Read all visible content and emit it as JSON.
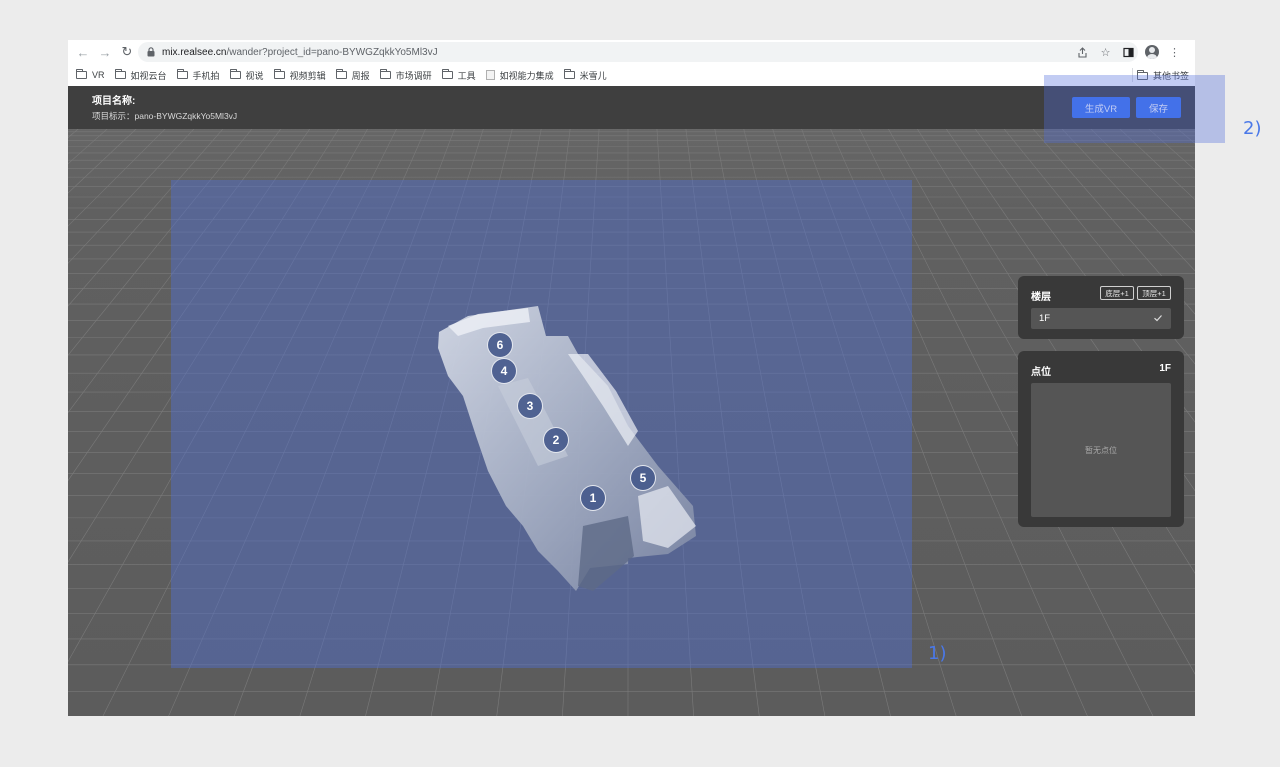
{
  "browser": {
    "url_host": "mix.realsee.cn",
    "url_path": "/wander?project_id=pano-BYWGZqkkYo5Ml3vJ",
    "bookmarks": [
      "VR",
      "如视云台",
      "手机拍",
      "视说",
      "视频剪辑",
      "周报",
      "市场调研",
      "工具",
      "如视能力集成",
      "米雪儿"
    ],
    "other_bookmarks": "其他书签"
  },
  "header": {
    "project_name_label": "项目名称:",
    "project_id_line": "项目标示：pano-BYWGZqkkYo5Ml3vJ",
    "generate_vr_label": "生成VR",
    "save_label": "保存"
  },
  "floor_panel": {
    "label": "楼层",
    "add_bottom_label": "底层+1",
    "add_top_label": "顶层+1",
    "selected_floor": "1F"
  },
  "points_panel": {
    "label": "点位",
    "floor": "1F",
    "empty_text": "暂无点位"
  },
  "pins": [
    "1",
    "2",
    "3",
    "4",
    "5",
    "6"
  ],
  "annotations": {
    "label_1": "1)",
    "label_2": "2)"
  },
  "colors": {
    "accent_button": "#3c73f0",
    "overlay": "#506ed2",
    "annotation_text": "#4a78e8"
  }
}
